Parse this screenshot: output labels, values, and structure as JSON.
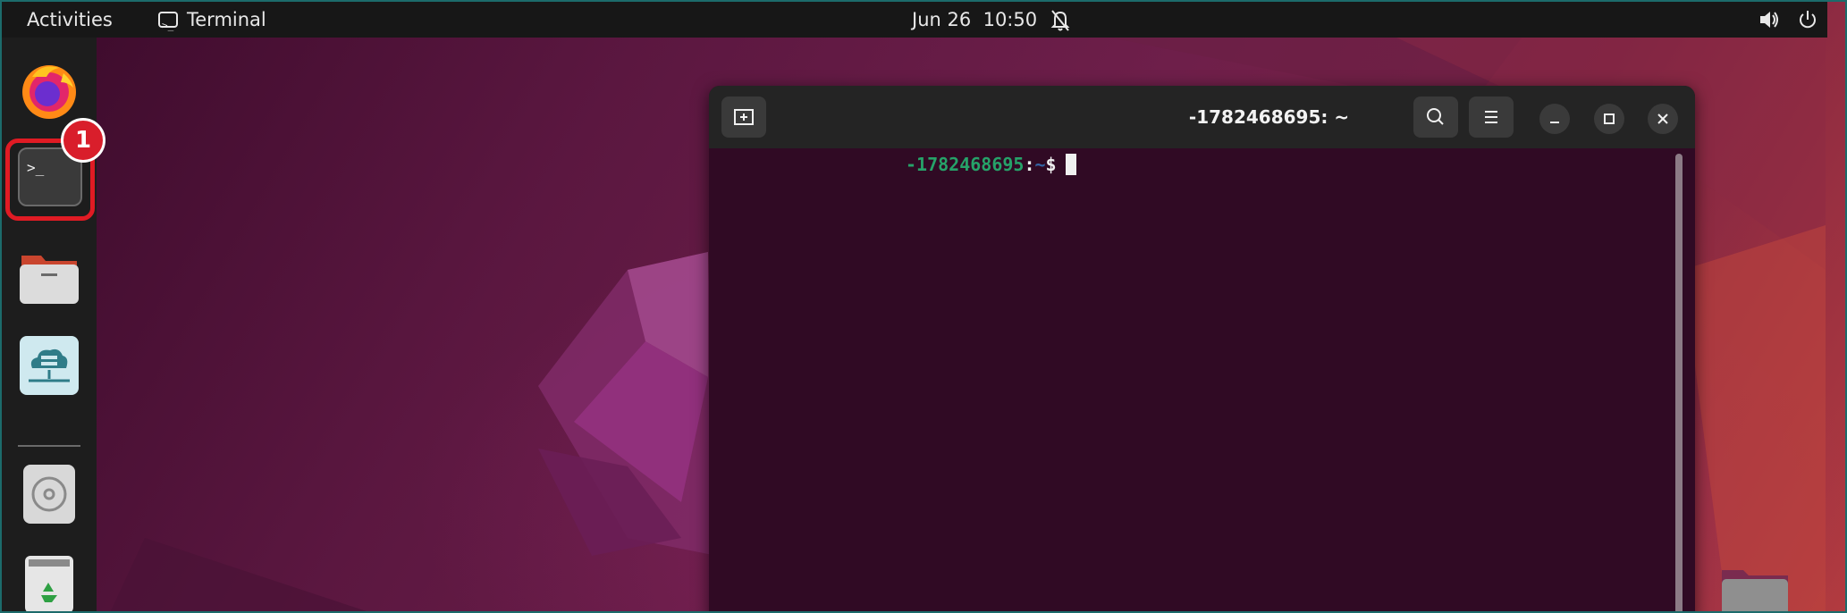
{
  "topbar": {
    "activities": "Activities",
    "app_name": "Terminal",
    "date": "Jun 26",
    "time": "10:50"
  },
  "dock": {
    "items": [
      {
        "name": "Firefox",
        "icon": "firefox-icon"
      },
      {
        "name": "Terminal",
        "icon": "terminal-icon",
        "active": true
      },
      {
        "name": "Files",
        "icon": "files-icon"
      },
      {
        "name": "Network App",
        "icon": "cloud-network-icon"
      },
      {
        "name": "Disc",
        "icon": "disc-icon"
      },
      {
        "name": "Trash",
        "icon": "trash-icon"
      }
    ],
    "step_badge": "1"
  },
  "terminal": {
    "title": "-1782468695: ~",
    "prompt_host": "-1782468695",
    "prompt_sep": ":",
    "prompt_dir": "~",
    "prompt_dollar": "$"
  },
  "colors": {
    "topbar_bg": "#171717",
    "dock_bg": "#1d1d1d",
    "terminal_bg": "#300a24",
    "highlight_red": "#e01b24",
    "prompt_green": "#26a269"
  }
}
